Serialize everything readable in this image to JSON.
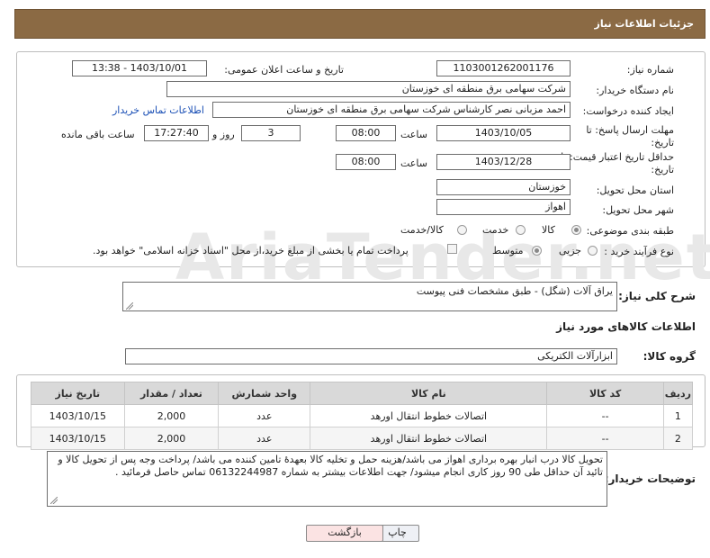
{
  "header": {
    "title": "جزئیات اطلاعات نیاز"
  },
  "watermark": "AriaTender.net",
  "form": {
    "need_number_label": "شماره نیاز:",
    "need_number": "1103001262001176",
    "announce_label": "تاریخ و ساعت اعلان عمومی:",
    "announce_value": "1403/10/01 - 13:38",
    "buyer_label": "نام دستگاه خریدار:",
    "buyer_value": "شرکت سهامی برق منطقه ای خوزستان",
    "creator_label": "ایجاد کننده درخواست:",
    "creator_value": "احمد مزبانی نصر کارشناس شرکت سهامی برق منطقه ای خوزستان",
    "contact_link": "اطلاعات تماس خریدار",
    "deadline_label_1": "مهلت ارسال پاسخ: تا",
    "deadline_label_2": "تاریخ:",
    "deadline_date": "1403/10/05",
    "time_label": "ساعت",
    "deadline_time": "08:00",
    "days_value": "3",
    "days_label": "روز و",
    "remaining_time": "17:27:40",
    "remaining_label": "ساعت باقی مانده",
    "validity_label_1": "حداقل تاریخ اعتبار قیمت: تا",
    "validity_label_2": "تاریخ:",
    "validity_date": "1403/12/28",
    "validity_time": "08:00",
    "province_label": "استان محل تحویل:",
    "province_value": "خوزستان",
    "city_label": "شهر محل تحویل:",
    "city_value": "اهواز",
    "category_label": "طبقه بندی موضوعی:",
    "category_options": [
      "کالا",
      "خدمت",
      "کالا/خدمت"
    ],
    "process_label": "نوع فرآیند خرید :",
    "process_options": [
      "جزیی",
      "متوسط"
    ],
    "payment_text": "پرداخت تمام یا بخشی از مبلغ خرید،از محل \"اسناد خزانه اسلامی\" خواهد بود."
  },
  "summary": {
    "label": "شرح کلی نیاز:",
    "value": "یراق آلات (شگل) - طبق مشخصات فنی پیوست"
  },
  "goods_section_title": "اطلاعات کالاهای مورد نیاز",
  "group": {
    "label": "گروه کالا:",
    "value": "ابزارآلات الکتریکی"
  },
  "table": {
    "headers": [
      "ردیف",
      "کد کالا",
      "نام کالا",
      "واحد شمارش",
      "تعداد / مقدار",
      "تاریخ نیاز"
    ],
    "rows": [
      [
        "1",
        "--",
        "اتصالات خطوط انتقال اورهد",
        "عدد",
        "2,000",
        "1403/10/15"
      ],
      [
        "2",
        "--",
        "اتصالات خطوط انتقال اورهد",
        "عدد",
        "2,000",
        "1403/10/15"
      ]
    ]
  },
  "buyer_notes": {
    "label": "توضیحات خریدار:",
    "value": "تحویل کالا درب انبار بهره برداری اهواز می باشد/هزینه حمل و تخلیه کالا بعهدهٔ تامین کننده می باشد/ پرداخت وجه پس از تحویل کالا و تائید آن حداقل طی 90 روز کاری انجام میشود/  جهت اطلاعات بیشتر به شماره  06132244987 تماس حاصل فرمائید ."
  },
  "buttons": {
    "print": "چاپ",
    "back": "بازگشت"
  }
}
